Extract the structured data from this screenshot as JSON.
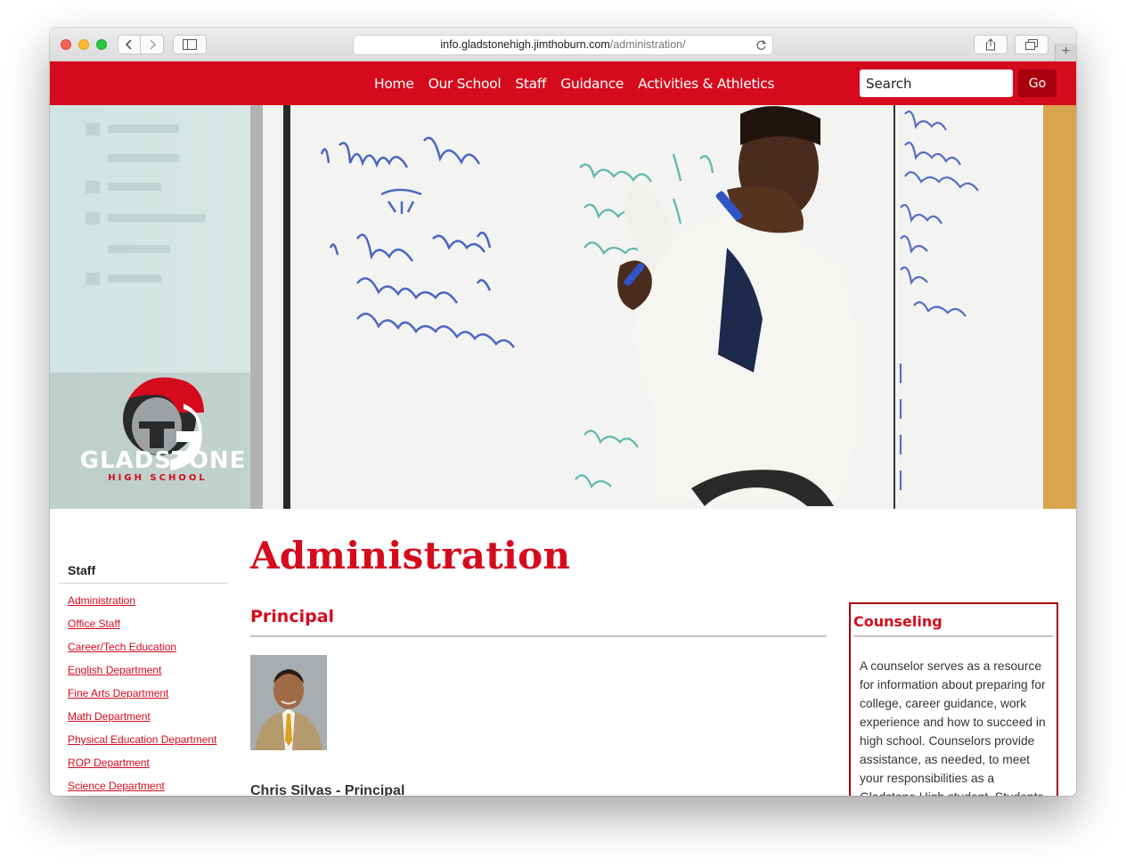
{
  "browser": {
    "url_host": "info.gladstonehigh.jimthoburn.com",
    "url_path": "/administration/"
  },
  "nav": {
    "links": [
      "Home",
      "Our School",
      "Staff",
      "Guidance",
      "Activities & Athletics"
    ],
    "search_placeholder": "Search",
    "go_label": "Go"
  },
  "hero": {
    "logo_name": "GLADSTONE",
    "logo_sub": "HIGH SCHOOL",
    "logo_icon": "spartan-helmet-icon"
  },
  "sidebar": {
    "title": "Staff",
    "links": [
      "Administration",
      "Office Staff",
      "Career/Tech Education",
      "English Department",
      "Fine Arts Department",
      "Math Department",
      "Physical Education Department",
      "ROP Department",
      "Science Department"
    ]
  },
  "main": {
    "title": "Administration",
    "section_heading": "Principal",
    "principal_name": "Chris Silvas - Principal"
  },
  "counseling": {
    "title": "Counseling",
    "text": "A counselor serves as a resource for information about preparing for college, career guidance, work experience and how to succeed in high school. Counselors provide assistance, as needed, to meet your responsibilities as a Gladstone High student. Students"
  },
  "colors": {
    "brand_red": "#d50b1d",
    "dark_red": "#a8000f"
  }
}
